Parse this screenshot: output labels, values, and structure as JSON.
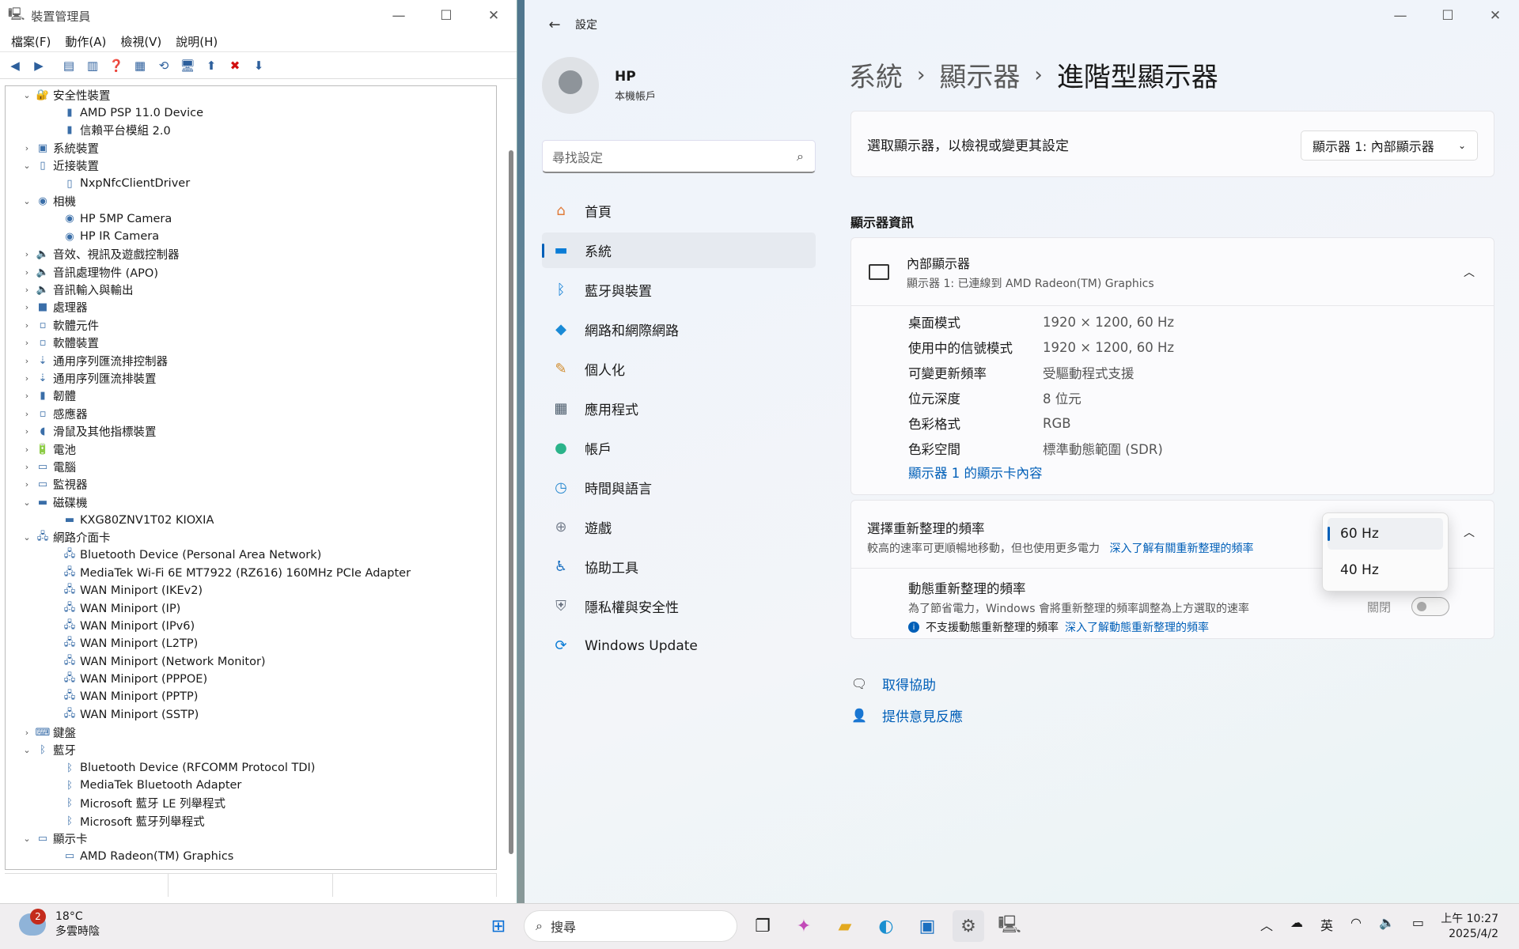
{
  "dm": {
    "title": "裝置管理員",
    "menu": [
      "檔案(F)",
      "動作(A)",
      "檢視(V)",
      "說明(H)"
    ],
    "tree": [
      {
        "lvl": 1,
        "exp": "⌄",
        "icon": "🔐",
        "label": "安全性裝置"
      },
      {
        "lvl": 2,
        "exp": "",
        "icon": "▮",
        "label": "AMD PSP 11.0 Device"
      },
      {
        "lvl": 2,
        "exp": "",
        "icon": "▮",
        "label": "信賴平台模組 2.0"
      },
      {
        "lvl": 1,
        "exp": "›",
        "icon": "▣",
        "label": "系統裝置"
      },
      {
        "lvl": 1,
        "exp": "⌄",
        "icon": "▯",
        "label": "近接裝置"
      },
      {
        "lvl": 2,
        "exp": "",
        "icon": "▯",
        "label": "NxpNfcClientDriver"
      },
      {
        "lvl": 1,
        "exp": "⌄",
        "icon": "◉",
        "label": "相機"
      },
      {
        "lvl": 2,
        "exp": "",
        "icon": "◉",
        "label": "HP 5MP Camera"
      },
      {
        "lvl": 2,
        "exp": "",
        "icon": "◉",
        "label": "HP IR Camera"
      },
      {
        "lvl": 1,
        "exp": "›",
        "icon": "🔈",
        "label": "音效、視訊及遊戲控制器"
      },
      {
        "lvl": 1,
        "exp": "›",
        "icon": "🔈",
        "label": "音訊處理物件 (APO)"
      },
      {
        "lvl": 1,
        "exp": "›",
        "icon": "🔈",
        "label": "音訊輸入與輸出"
      },
      {
        "lvl": 1,
        "exp": "›",
        "icon": "■",
        "label": "處理器"
      },
      {
        "lvl": 1,
        "exp": "›",
        "icon": "▫",
        "label": "軟體元件"
      },
      {
        "lvl": 1,
        "exp": "›",
        "icon": "▫",
        "label": "軟體裝置"
      },
      {
        "lvl": 1,
        "exp": "›",
        "icon": "⇣",
        "label": "通用序列匯流排控制器"
      },
      {
        "lvl": 1,
        "exp": "›",
        "icon": "⇣",
        "label": "通用序列匯流排裝置"
      },
      {
        "lvl": 1,
        "exp": "›",
        "icon": "▮",
        "label": "韌體"
      },
      {
        "lvl": 1,
        "exp": "›",
        "icon": "▫",
        "label": "感應器"
      },
      {
        "lvl": 1,
        "exp": "›",
        "icon": "◖",
        "label": "滑鼠及其他指標裝置"
      },
      {
        "lvl": 1,
        "exp": "›",
        "icon": "🔋",
        "label": "電池"
      },
      {
        "lvl": 1,
        "exp": "›",
        "icon": "▭",
        "label": "電腦"
      },
      {
        "lvl": 1,
        "exp": "›",
        "icon": "▭",
        "label": "監視器"
      },
      {
        "lvl": 1,
        "exp": "⌄",
        "icon": "▬",
        "label": "磁碟機"
      },
      {
        "lvl": 2,
        "exp": "",
        "icon": "▬",
        "label": "KXG80ZNV1T02 KIOXIA"
      },
      {
        "lvl": 1,
        "exp": "⌄",
        "icon": "🖧",
        "label": "網路介面卡"
      },
      {
        "lvl": 2,
        "exp": "",
        "icon": "🖧",
        "label": "Bluetooth Device (Personal Area Network)"
      },
      {
        "lvl": 2,
        "exp": "",
        "icon": "🖧",
        "label": "MediaTek Wi-Fi 6E MT7922 (RZ616) 160MHz PCIe Adapter"
      },
      {
        "lvl": 2,
        "exp": "",
        "icon": "🖧",
        "label": "WAN Miniport (IKEv2)"
      },
      {
        "lvl": 2,
        "exp": "",
        "icon": "🖧",
        "label": "WAN Miniport (IP)"
      },
      {
        "lvl": 2,
        "exp": "",
        "icon": "🖧",
        "label": "WAN Miniport (IPv6)"
      },
      {
        "lvl": 2,
        "exp": "",
        "icon": "🖧",
        "label": "WAN Miniport (L2TP)"
      },
      {
        "lvl": 2,
        "exp": "",
        "icon": "🖧",
        "label": "WAN Miniport (Network Monitor)"
      },
      {
        "lvl": 2,
        "exp": "",
        "icon": "🖧",
        "label": "WAN Miniport (PPPOE)"
      },
      {
        "lvl": 2,
        "exp": "",
        "icon": "🖧",
        "label": "WAN Miniport (PPTP)"
      },
      {
        "lvl": 2,
        "exp": "",
        "icon": "🖧",
        "label": "WAN Miniport (SSTP)"
      },
      {
        "lvl": 1,
        "exp": "›",
        "icon": "⌨",
        "label": "鍵盤"
      },
      {
        "lvl": 1,
        "exp": "⌄",
        "icon": "ᛒ",
        "label": "藍牙"
      },
      {
        "lvl": 2,
        "exp": "",
        "icon": "ᛒ",
        "label": "Bluetooth Device (RFCOMM Protocol TDI)"
      },
      {
        "lvl": 2,
        "exp": "",
        "icon": "ᛒ",
        "label": "MediaTek Bluetooth Adapter"
      },
      {
        "lvl": 2,
        "exp": "",
        "icon": "ᛒ",
        "label": "Microsoft 藍牙 LE 列舉程式"
      },
      {
        "lvl": 2,
        "exp": "",
        "icon": "ᛒ",
        "label": "Microsoft 藍牙列舉程式"
      },
      {
        "lvl": 1,
        "exp": "⌄",
        "icon": "▭",
        "label": "顯示卡"
      },
      {
        "lvl": 2,
        "exp": "",
        "icon": "▭",
        "label": "AMD Radeon(TM) Graphics"
      }
    ]
  },
  "settings": {
    "title": "設定",
    "user": {
      "name": "HP",
      "sub": "本機帳戶"
    },
    "search_placeholder": "尋找設定",
    "nav": [
      {
        "icon": "⌂",
        "label": "首頁",
        "color": "#e07b39",
        "active": false
      },
      {
        "icon": "▬",
        "label": "系統",
        "color": "#0a7cd6",
        "active": true
      },
      {
        "icon": "ᛒ",
        "label": "藍牙與裝置",
        "color": "#0a7cd6",
        "active": false
      },
      {
        "icon": "◆",
        "label": "網路和網際網路",
        "color": "#1a8ad6",
        "active": false
      },
      {
        "icon": "✎",
        "label": "個人化",
        "color": "#d08a2a",
        "active": false
      },
      {
        "icon": "▦",
        "label": "應用程式",
        "color": "#4a5a6a",
        "active": false
      },
      {
        "icon": "●",
        "label": "帳戶",
        "color": "#2bb38a",
        "active": false
      },
      {
        "icon": "◷",
        "label": "時間與語言",
        "color": "#2a8ad0",
        "active": false
      },
      {
        "icon": "⊕",
        "label": "遊戲",
        "color": "#7a8290",
        "active": false
      },
      {
        "icon": "♿",
        "label": "協助工具",
        "color": "#1a6fc0",
        "active": false
      },
      {
        "icon": "⛨",
        "label": "隱私權與安全性",
        "color": "#6a7280",
        "active": false
      },
      {
        "icon": "⟳",
        "label": "Windows Update",
        "color": "#0a7cd6",
        "active": false
      }
    ],
    "crumb": [
      "系統",
      "顯示器",
      "進階型顯示器"
    ],
    "select_label": "選取顯示器，以檢視或變更其設定",
    "display_dropdown": "顯示器 1: 內部顯示器",
    "section_title": "顯示器資訊",
    "info": {
      "title": "內部顯示器",
      "sub": "顯示器 1: 已連線到 AMD Radeon(TM) Graphics",
      "rows": [
        [
          "桌面模式",
          "1920 × 1200, 60 Hz"
        ],
        [
          "使用中的信號模式",
          "1920 × 1200, 60 Hz"
        ],
        [
          "可變更新頻率",
          "受驅動程式支援"
        ],
        [
          "位元深度",
          "8 位元"
        ],
        [
          "色彩格式",
          "RGB"
        ],
        [
          "色彩空間",
          "標準動態範圍 (SDR)"
        ]
      ],
      "link": "顯示器 1 的顯示卡內容"
    },
    "refresh": {
      "title": "選擇重新整理的頻率",
      "sub": "較高的速率可更順暢地移動，但也使用更多電力",
      "link": "深入了解有關重新整理的頻率",
      "dyn_title": "動態重新整理的頻率",
      "dyn_sub": "為了節省電力，Windows 會將重新整理的頻率調整為上方選取的速率",
      "dyn_note": "不支援動態重新整理的頻率",
      "dyn_link": "深入了解動態重新整理的頻率",
      "toggle_label": "關閉",
      "options": [
        "60 Hz",
        "40 Hz"
      ]
    },
    "help": [
      "取得協助",
      "提供意見反應"
    ]
  },
  "taskbar": {
    "temp": "18°C",
    "weather": "多雲時陰",
    "badge": "2",
    "search": "搜尋",
    "ime": "英",
    "time": "上午 10:27",
    "date": "2025/4/2"
  }
}
